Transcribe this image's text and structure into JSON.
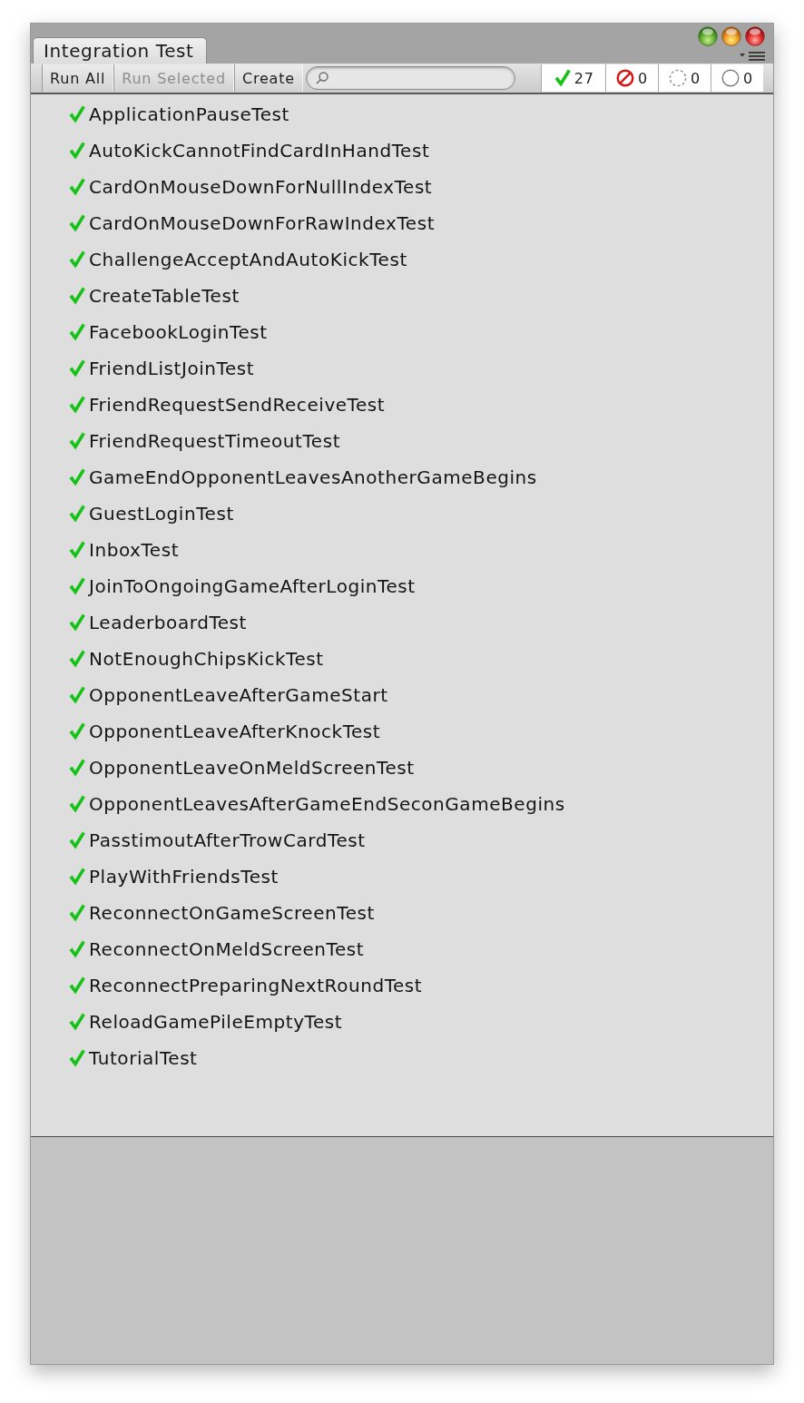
{
  "tabs": [
    {
      "label": "Integration Test",
      "selected": true
    }
  ],
  "toolbar": {
    "buttons": [
      {
        "label": "Run All",
        "disabled": false
      },
      {
        "label": "Run Selected",
        "disabled": true
      },
      {
        "label": "Create",
        "disabled": false
      }
    ],
    "counters": [
      {
        "kind": "passed",
        "count": "27"
      },
      {
        "kind": "failed",
        "count": "0"
      },
      {
        "kind": "ignored",
        "count": "0"
      },
      {
        "kind": "not_run",
        "count": "0"
      }
    ]
  },
  "tests": [
    {
      "name": "ApplicationPauseTest",
      "passed": true,
      "selected": false
    },
    {
      "name": "AutoKickCannotFindCardInHandTest",
      "passed": true,
      "selected": false
    },
    {
      "name": "CardOnMouseDownForNullIndexTest",
      "passed": true,
      "selected": false
    },
    {
      "name": "CardOnMouseDownForRawIndexTest",
      "passed": true,
      "selected": false
    },
    {
      "name": "ChallengeAcceptAndAutoKickTest",
      "passed": true,
      "selected": false
    },
    {
      "name": "CreateTableTest",
      "passed": true,
      "selected": false
    },
    {
      "name": "FacebookLoginTest",
      "passed": true,
      "selected": false
    },
    {
      "name": "FriendListJoinTest",
      "passed": true,
      "selected": false
    },
    {
      "name": "FriendRequestSendReceiveTest",
      "passed": true,
      "selected": false
    },
    {
      "name": "FriendRequestTimeoutTest",
      "passed": true,
      "selected": false
    },
    {
      "name": "GameEndOpponentLeavesAnotherGameBegins",
      "passed": true,
      "selected": false
    },
    {
      "name": "GuestLoginTest",
      "passed": true,
      "selected": false
    },
    {
      "name": "InboxTest",
      "passed": true,
      "selected": false
    },
    {
      "name": "JoinToOngoingGameAfterLoginTest",
      "passed": true,
      "selected": false
    },
    {
      "name": "LeaderboardTest",
      "passed": true,
      "selected": false
    },
    {
      "name": "NotEnoughChipsKickTest",
      "passed": true,
      "selected": false
    },
    {
      "name": "OpponentLeaveAfterGameStart",
      "passed": true,
      "selected": false
    },
    {
      "name": "OpponentLeaveAfterKnockTest",
      "passed": true,
      "selected": false
    },
    {
      "name": "OpponentLeaveOnMeldScreenTest",
      "passed": true,
      "selected": false
    },
    {
      "name": "OpponentLeavesAfterGameEndSeconGameBegins",
      "passed": true,
      "selected": false
    },
    {
      "name": "PasstimoutAfterTrowCardTest",
      "passed": true,
      "selected": false
    },
    {
      "name": "PlayWithFriendsTest",
      "passed": true,
      "selected": false
    },
    {
      "name": "ReconnectOnGameScreenTest",
      "passed": true,
      "selected": false
    },
    {
      "name": "ReconnectOnMeldScreenTest",
      "passed": true,
      "selected": false
    },
    {
      "name": "ReconnectPreparingNextRoundTest",
      "passed": true,
      "selected": false
    },
    {
      "name": "ReloadGamePileEmptyTest",
      "passed": true,
      "selected": false
    },
    {
      "name": "TutorialTest",
      "passed": true,
      "selected": false
    }
  ]
}
